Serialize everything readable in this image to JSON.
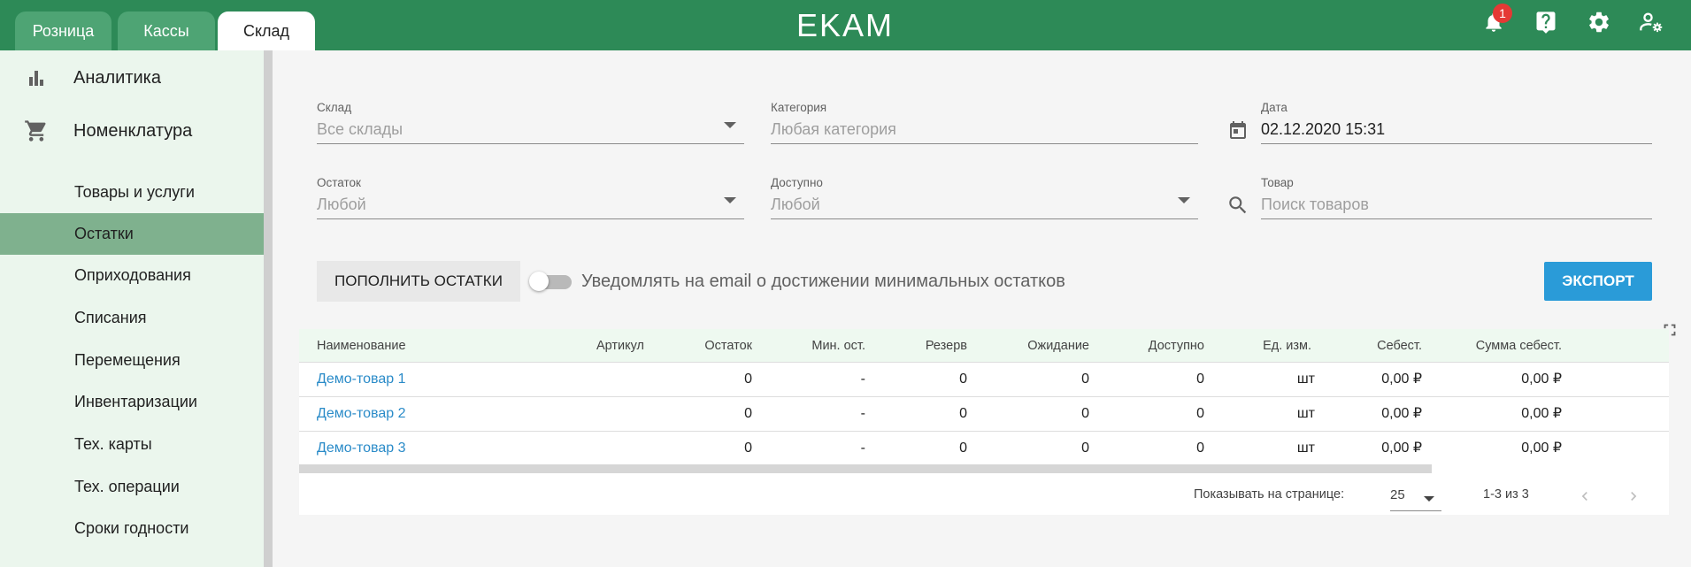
{
  "header": {
    "tabs": [
      {
        "label": "Розница",
        "active": false
      },
      {
        "label": "Кассы",
        "active": false
      },
      {
        "label": "Склад",
        "active": true
      }
    ],
    "logo": "EKAM",
    "notifications_count": "1",
    "icons": [
      "bell-icon",
      "help-icon",
      "gear-icon",
      "user-settings-icon"
    ],
    "brand_color": "#2d8a57"
  },
  "sidebar": {
    "main_items": [
      {
        "label": "Аналитика",
        "icon": "bar-chart-icon"
      },
      {
        "label": "Номенклатура",
        "icon": "cart-icon"
      }
    ],
    "sub_items": [
      {
        "label": "Товары и услуги",
        "active": false
      },
      {
        "label": "Остатки",
        "active": true
      },
      {
        "label": "Оприходования",
        "active": false
      },
      {
        "label": "Списания",
        "active": false
      },
      {
        "label": "Перемещения",
        "active": false
      },
      {
        "label": "Инвентаризации",
        "active": false
      },
      {
        "label": "Тех. карты",
        "active": false
      },
      {
        "label": "Тех. операции",
        "active": false
      },
      {
        "label": "Сроки годности",
        "active": false
      }
    ]
  },
  "filters": {
    "warehouse": {
      "label": "Склад",
      "placeholder": "Все склады"
    },
    "category": {
      "label": "Категория",
      "placeholder": "Любая категория"
    },
    "date": {
      "label": "Дата",
      "value": "02.12.2020 15:31",
      "icon": "calendar-icon"
    },
    "remainder": {
      "label": "Остаток",
      "placeholder": "Любой"
    },
    "available": {
      "label": "Доступно",
      "placeholder": "Любой"
    },
    "product": {
      "label": "Товар",
      "placeholder": "Поиск товаров",
      "icon": "search-icon"
    }
  },
  "actions": {
    "replenish_label": "ПОПОЛНИТЬ ОСТАТКИ",
    "notify_toggle_label": "Уведомлять на email о достижении минимальных остатков",
    "notify_enabled": false,
    "export_label": "ЭКСПОРТ",
    "export_color": "#2a9bd8"
  },
  "table": {
    "columns": [
      "Наименование",
      "Артикул",
      "Остаток",
      "Мин. ост.",
      "Резерв",
      "Ожидание",
      "Доступно",
      "Ед. изм.",
      "Себест.",
      "Сумма себест."
    ],
    "rows": [
      [
        "Демо-товар 1",
        "",
        "0",
        "-",
        "0",
        "0",
        "0",
        "шт",
        "0,00 ₽",
        "0,00 ₽"
      ],
      [
        "Демо-товар 2",
        "",
        "0",
        "-",
        "0",
        "0",
        "0",
        "шт",
        "0,00 ₽",
        "0,00 ₽"
      ],
      [
        "Демо-товар 3",
        "",
        "0",
        "-",
        "0",
        "0",
        "0",
        "шт",
        "0,00 ₽",
        "0,00 ₽"
      ]
    ],
    "link_color": "#2a8bc8"
  },
  "pagination": {
    "per_page_label": "Показывать на странице:",
    "per_page_value": "25",
    "range": "1-3 из 3"
  }
}
